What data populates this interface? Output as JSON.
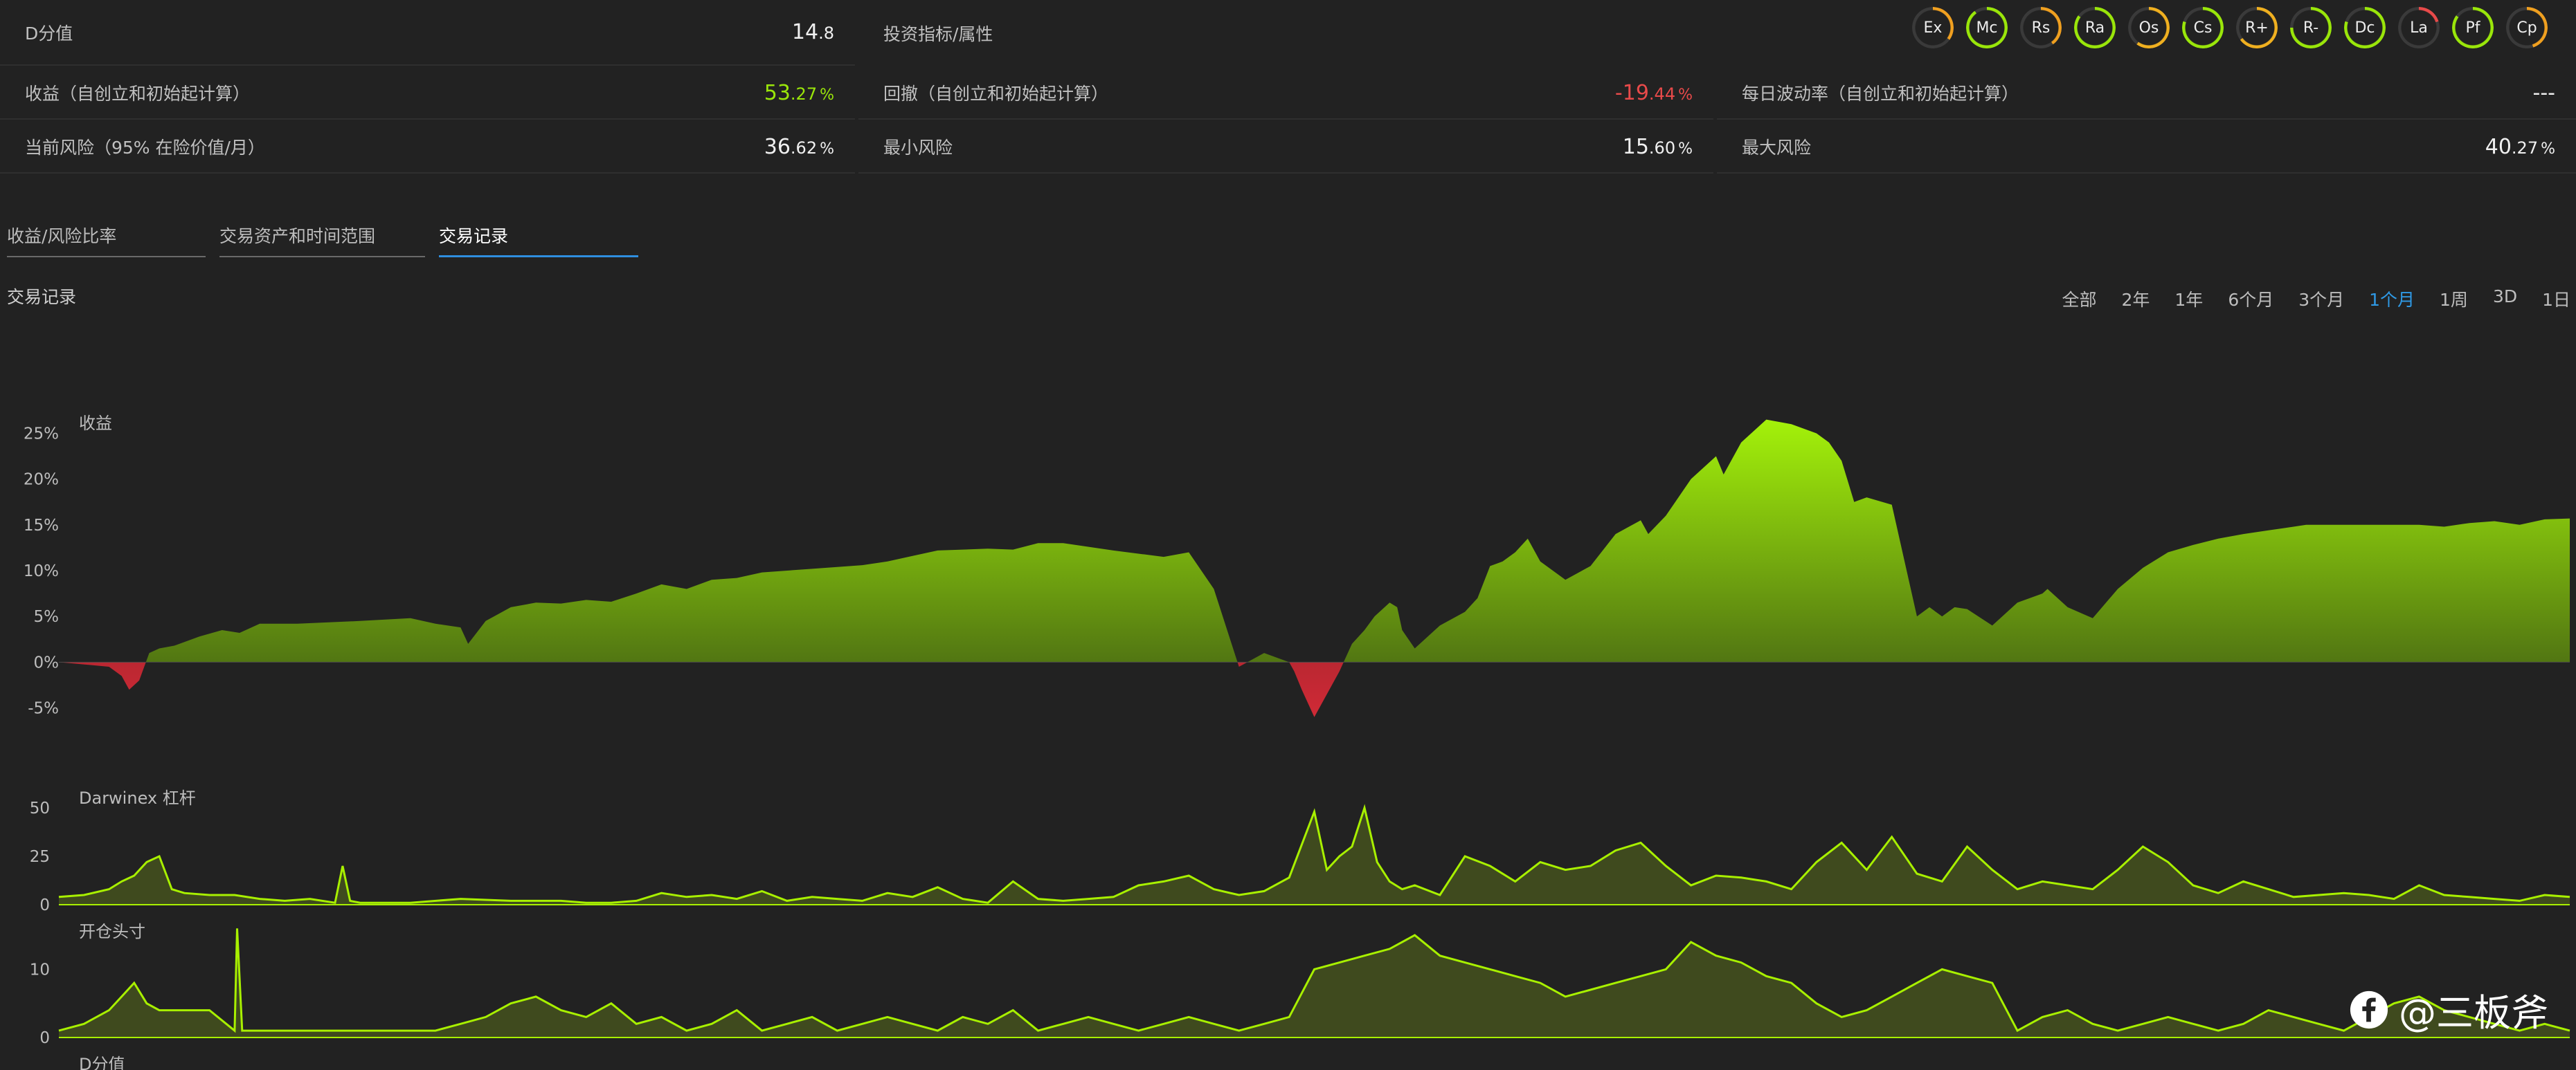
{
  "stats": {
    "dscore": {
      "label": "D分值",
      "int": "14",
      "dec": ".8"
    },
    "attributes_label": "投资指标/属性",
    "return": {
      "label": "收益（自创立和初始起计算）",
      "int": "53",
      "dec": ".27",
      "pct": "%"
    },
    "drawdown": {
      "label": "回撤（自创立和初始起计算）",
      "int": "-19",
      "dec": ".44",
      "pct": "%"
    },
    "volatility": {
      "label": "每日波动率（自创立和初始起计算）",
      "value": "---"
    },
    "current_risk": {
      "label": "当前风险（95% 在险价值/月）",
      "int": "36",
      "dec": ".62",
      "pct": "%"
    },
    "min_risk": {
      "label": "最小风险",
      "int": "15",
      "dec": ".60",
      "pct": "%"
    },
    "max_risk": {
      "label": "最大风险",
      "int": "40",
      "dec": ".27",
      "pct": "%"
    }
  },
  "badges": [
    {
      "name": "Ex",
      "percent": 35,
      "color": "#f0a020"
    },
    {
      "name": "Mc",
      "percent": 90,
      "color": "#9ae60a"
    },
    {
      "name": "Rs",
      "percent": 40,
      "color": "#f0a020"
    },
    {
      "name": "Ra",
      "percent": 85,
      "color": "#9ae60a"
    },
    {
      "name": "Os",
      "percent": 60,
      "color": "#f0b020"
    },
    {
      "name": "Cs",
      "percent": 80,
      "color": "#9ae60a"
    },
    {
      "name": "R+",
      "percent": 65,
      "color": "#f0b020"
    },
    {
      "name": "R-",
      "percent": 75,
      "color": "#9ae60a"
    },
    {
      "name": "Dc",
      "percent": 80,
      "color": "#9ae60a"
    },
    {
      "name": "La",
      "percent": 20,
      "color": "#e84a4a"
    },
    {
      "name": "Pf",
      "percent": 85,
      "color": "#9ae60a"
    },
    {
      "name": "Cp",
      "percent": 45,
      "color": "#f0a020"
    }
  ],
  "tabs": [
    {
      "label": "收益/风险比率",
      "active": false
    },
    {
      "label": "交易资产和时间范围",
      "active": false
    },
    {
      "label": "交易记录",
      "active": true
    }
  ],
  "section_title": "交易记录",
  "ranges": [
    {
      "label": "全部",
      "active": false
    },
    {
      "label": "2年",
      "active": false
    },
    {
      "label": "1年",
      "active": false
    },
    {
      "label": "6个月",
      "active": false
    },
    {
      "label": "3个月",
      "active": false
    },
    {
      "label": "1个月",
      "active": true
    },
    {
      "label": "1周",
      "active": false
    },
    {
      "label": "3D",
      "active": false
    },
    {
      "label": "1日",
      "active": false
    }
  ],
  "watermark": "@三板斧",
  "colors": {
    "positive": "#9ae60a",
    "negative": "#c0303a",
    "fill_dark": "#3f4a1e",
    "line": "#a8f000"
  },
  "chart_data": [
    {
      "type": "area",
      "title": "收益",
      "unit": "%",
      "ylim": [
        -7,
        27
      ],
      "yticks": [
        25,
        20,
        15,
        10,
        5,
        0,
        -5
      ],
      "yticklabels": [
        "25%",
        "20%",
        "15%",
        "10%",
        "5%",
        "0%",
        "-5%"
      ],
      "x": [
        0,
        1.2,
        2,
        2.5,
        2.8,
        3.2,
        3.6,
        4,
        4.6,
        5.6,
        6.5,
        7.2,
        8,
        9.5,
        12,
        14,
        15,
        16,
        16.3,
        17,
        18,
        19,
        20,
        21,
        22,
        23,
        24,
        25,
        26,
        27,
        28,
        30,
        32,
        33,
        34,
        35,
        36,
        37,
        38,
        39,
        40,
        42,
        44,
        45,
        46,
        47,
        48,
        49,
        49.2,
        49.5,
        50,
        51,
        51.5,
        52,
        52.4,
        52.8,
        53,
        53.3,
        53.5,
        54,
        55,
        56,
        56.5,
        57,
        57.5,
        58,
        58.5,
        59,
        60,
        61,
        62,
        63,
        63.3,
        64,
        65,
        66,
        66.3,
        67,
        68,
        69,
        70,
        70.5,
        71,
        71.5,
        72,
        73,
        74,
        74.5,
        75,
        75.5,
        76,
        77,
        78,
        79,
        79.2,
        80,
        81,
        82,
        83,
        84,
        85,
        86,
        87,
        88,
        89,
        89.5,
        90,
        90.3,
        91,
        91.5,
        92,
        93,
        94,
        95,
        96,
        97,
        98,
        99,
        100
      ],
      "values": [
        0,
        -0.3,
        -0.5,
        -1.5,
        -3,
        -2,
        1,
        1.5,
        1.8,
        2.8,
        3.5,
        3.2,
        4.2,
        4.2,
        4.5,
        4.8,
        4.2,
        3.8,
        2,
        4.5,
        6,
        6.5,
        6.4,
        6.8,
        6.6,
        7.5,
        8.5,
        8,
        9,
        9.2,
        9.8,
        10.2,
        10.6,
        11,
        11.6,
        12.2,
        12.3,
        12.4,
        12.3,
        13,
        13,
        12.2,
        11.5,
        12,
        8,
        -0.5,
        1,
        0,
        -1,
        -3,
        -6,
        -1,
        2,
        3.5,
        5,
        6,
        6.5,
        6,
        3.5,
        1.5,
        4,
        5.5,
        7,
        10.5,
        11,
        12,
        13.5,
        11,
        9,
        10.5,
        14,
        15.5,
        14,
        16,
        20,
        22.5,
        20.5,
        24,
        26.5,
        26,
        25,
        24,
        22,
        17.5,
        18,
        17.2,
        5,
        6,
        5,
        6,
        5.8,
        4,
        6.5,
        7.5,
        8,
        6,
        4.8,
        8,
        10.3,
        12,
        12.8,
        13.5,
        14,
        14.4,
        14.8,
        15,
        15,
        15,
        15,
        15,
        15,
        15,
        15,
        14.8,
        15.2,
        15.4,
        15,
        15.6,
        15.7,
        15.2,
        15.8,
        15.5
      ]
    },
    {
      "type": "area",
      "title": "Darwinex 杠杆",
      "ylim": [
        0,
        50
      ],
      "yticks": [
        50,
        25,
        0
      ],
      "x": [
        0,
        1,
        2,
        2.5,
        3,
        3.5,
        4,
        4.5,
        5,
        6,
        7,
        8,
        9,
        10,
        11,
        11.3,
        11.6,
        12,
        14,
        16,
        18,
        20,
        21,
        22,
        23,
        24,
        25,
        26,
        27,
        28,
        29,
        30,
        31,
        32,
        33,
        34,
        35,
        36,
        37,
        38,
        39,
        40,
        41,
        42,
        43,
        44,
        45,
        46,
        47,
        48,
        49,
        50,
        50.5,
        51,
        51.5,
        52,
        52.5,
        53,
        53.5,
        54,
        55,
        56,
        57,
        58,
        59,
        60,
        61,
        62,
        63,
        64,
        65,
        66,
        67,
        68,
        69,
        70,
        71,
        72,
        73,
        74,
        75,
        76,
        77,
        78,
        79,
        80,
        81,
        82,
        83,
        84,
        85,
        86,
        87,
        88,
        89,
        90,
        91,
        92,
        93,
        94,
        95,
        96,
        97,
        98,
        99,
        100
      ],
      "values": [
        4,
        5,
        8,
        12,
        15,
        22,
        25,
        8,
        6,
        5,
        5,
        3,
        2,
        3,
        1,
        20,
        2,
        1,
        1,
        3,
        2,
        2,
        1,
        1,
        2,
        6,
        4,
        5,
        3,
        7,
        2,
        4,
        3,
        2,
        6,
        4,
        9,
        3,
        1,
        12,
        3,
        2,
        3,
        4,
        10,
        12,
        15,
        8,
        5,
        7,
        14,
        48,
        18,
        25,
        30,
        50,
        22,
        12,
        8,
        10,
        5,
        25,
        20,
        12,
        22,
        18,
        20,
        28,
        32,
        20,
        10,
        15,
        14,
        12,
        8,
        22,
        32,
        18,
        35,
        16,
        12,
        30,
        18,
        8,
        12,
        10,
        8,
        18,
        30,
        22,
        10,
        6,
        12,
        8,
        4,
        5,
        6,
        5,
        3,
        10,
        5,
        4,
        3,
        2,
        5,
        4
      ]
    },
    {
      "type": "area",
      "title": "开仓头寸",
      "ylim": [
        0,
        14
      ],
      "yticks": [
        10,
        0
      ],
      "x": [
        0,
        1,
        2,
        2.5,
        3,
        3.5,
        4,
        5,
        6,
        7,
        7.1,
        7.3,
        7.5,
        9,
        11,
        13,
        15,
        16,
        17,
        18,
        19,
        20,
        21,
        22,
        23,
        24,
        25,
        26,
        27,
        28,
        29,
        30,
        31,
        32,
        33,
        34,
        35,
        36,
        37,
        38,
        39,
        40,
        41,
        42,
        43,
        44,
        45,
        46,
        47,
        48,
        49,
        50,
        51,
        52,
        53,
        54,
        55,
        56,
        57,
        58,
        59,
        60,
        61,
        62,
        63,
        64,
        65,
        66,
        67,
        68,
        69,
        70,
        71,
        72,
        73,
        74,
        75,
        76,
        77,
        78,
        79,
        80,
        81,
        82,
        83,
        84,
        85,
        86,
        87,
        88,
        89,
        90,
        91,
        92,
        93,
        94,
        95,
        96,
        97,
        98,
        99,
        100
      ],
      "values": [
        1,
        2,
        4,
        6,
        8,
        5,
        4,
        4,
        4,
        1,
        16,
        1,
        1,
        1,
        1,
        1,
        1,
        2,
        3,
        5,
        6,
        4,
        3,
        5,
        2,
        3,
        1,
        2,
        4,
        1,
        2,
        3,
        1,
        2,
        3,
        2,
        1,
        3,
        2,
        4,
        1,
        2,
        3,
        2,
        1,
        2,
        3,
        2,
        1,
        2,
        3,
        10,
        11,
        12,
        13,
        15,
        12,
        11,
        10,
        9,
        8,
        6,
        7,
        8,
        9,
        10,
        14,
        12,
        11,
        9,
        8,
        5,
        3,
        4,
        6,
        8,
        10,
        9,
        8,
        1,
        3,
        4,
        2,
        1,
        2,
        3,
        2,
        1,
        2,
        4,
        3,
        2,
        1,
        3,
        5,
        6,
        4,
        3,
        2,
        1,
        2,
        1,
        1
      ]
    }
  ],
  "next_chart_label": "D分值"
}
